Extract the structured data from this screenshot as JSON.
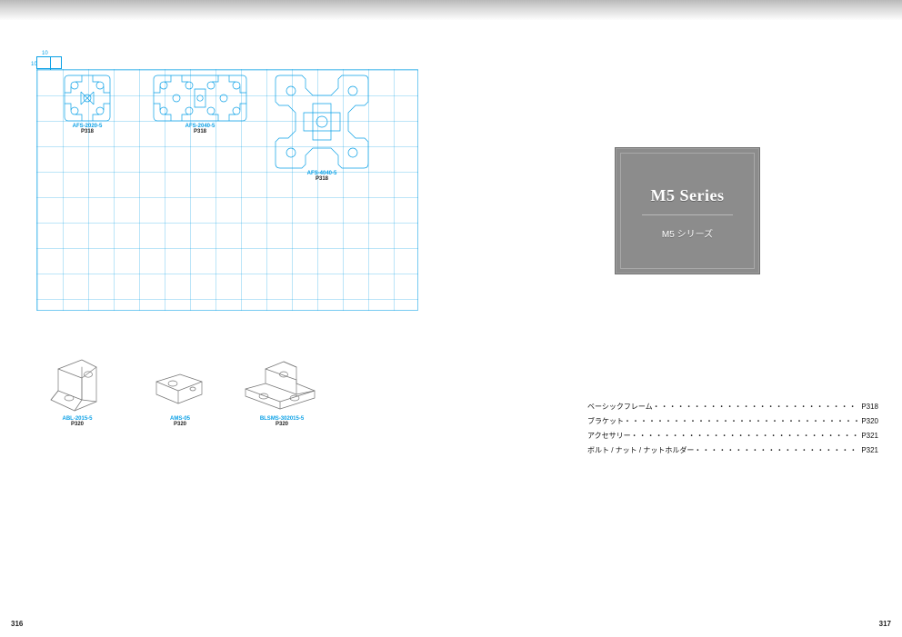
{
  "pages": {
    "left": "316",
    "right": "317"
  },
  "grid": {
    "scale_h": "10",
    "scale_v": "10"
  },
  "profiles": [
    {
      "code": "AFS-2020-5",
      "page": "P318"
    },
    {
      "code": "AFS-2040-5",
      "page": "P318"
    },
    {
      "code": "AFS-4040-5",
      "page": "P318"
    }
  ],
  "brackets": [
    {
      "code": "ABL-2015-5",
      "page": "P320"
    },
    {
      "code": "AMS-05",
      "page": "P320"
    },
    {
      "code": "BLSMS-302015-5",
      "page": "P320"
    }
  ],
  "title": {
    "en": "M5 Series",
    "jp": "M5 シリーズ"
  },
  "toc": [
    {
      "label": "ベーシックフレーム",
      "page": "P318"
    },
    {
      "label": "ブラケット",
      "page": "P320"
    },
    {
      "label": "アクセサリー",
      "page": "P321"
    },
    {
      "label": "ボルト / ナット / ナットホルダー",
      "page": "P321"
    }
  ]
}
